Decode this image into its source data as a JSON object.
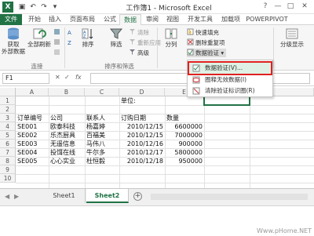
{
  "app": {
    "logo": "X",
    "title": "工作簿1 - Microsoft Excel",
    "win_buttons": [
      "?",
      "—",
      "□",
      "✕"
    ],
    "qat_icons": [
      "save-icon",
      "undo-icon",
      "redo-icon",
      "customize-icon"
    ]
  },
  "tabs": [
    {
      "label": "文件",
      "kind": "file"
    },
    {
      "label": "开始"
    },
    {
      "label": "插入"
    },
    {
      "label": "页面布局"
    },
    {
      "label": "公式"
    },
    {
      "label": "数据",
      "active": true
    },
    {
      "label": "审阅"
    },
    {
      "label": "视图"
    },
    {
      "label": "开发工具"
    },
    {
      "label": "加载项"
    },
    {
      "label": "POWERPIVOT"
    }
  ],
  "ribbon": {
    "get_external": "获取\n外部数据",
    "refresh_all": "全部刷新",
    "sort": "排序",
    "filter": "筛选",
    "clear": "清除",
    "reapply": "重新应用",
    "advanced": "高级",
    "text_to_columns": "分列",
    "flash_fill": "快速填充",
    "remove_duplicates": "删除重复项",
    "data_validation": "数据验证",
    "outline": "分级显示",
    "group_connections": "连接",
    "group_sort_filter": "排序和筛选"
  },
  "dropdown": {
    "items": [
      "数据验证(V)...",
      "圈释无效数据(I)",
      "清除验证标识圈(R)"
    ]
  },
  "formula_bar": {
    "name_box": "F1",
    "fx": "fx",
    "cancel": "✕",
    "enter": "✓"
  },
  "grid": {
    "columns": [
      "A",
      "B",
      "C",
      "D",
      "E",
      "F"
    ],
    "rows": [
      "1",
      "2",
      "3",
      "4",
      "5",
      "6",
      "7",
      "8",
      "9",
      "10"
    ],
    "unit_label": "单位:",
    "headers": [
      "订单编号",
      "公司",
      "联系人",
      "订购日期",
      "数量"
    ],
    "data": [
      [
        "SE001",
        "欧泰科技",
        "杨嘉婷",
        "2010/12/15",
        "6600000"
      ],
      [
        "SE002",
        "乐杰厨具",
        "百福美",
        "2010/12/15",
        "7000000"
      ],
      [
        "SE003",
        "无遥信息",
        "马伟八",
        "2010/12/16",
        "900000"
      ],
      [
        "SE004",
        "投饵在线",
        "牛尔多",
        "2010/12/17",
        "5800000"
      ],
      [
        "SE005",
        "心心实业",
        "杜恒毅",
        "2010/12/18",
        "950000"
      ]
    ]
  },
  "sheets": {
    "tabs": [
      "Sheet1",
      "Sheet2"
    ],
    "active": "Sheet2",
    "add": "+"
  },
  "watermark": "Www.pHome.NET"
}
